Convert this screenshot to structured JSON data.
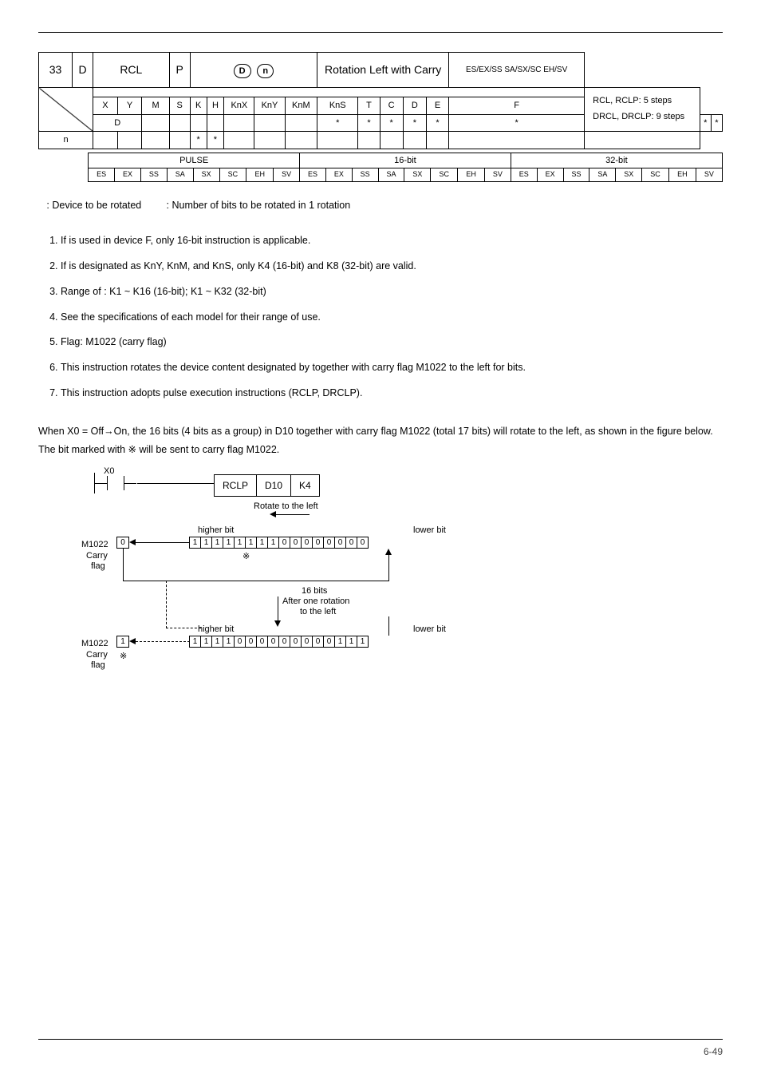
{
  "header": {
    "api_num": "33",
    "d": "D",
    "mnemonic": "RCL",
    "p": "P",
    "operand_d": "D",
    "operand_n": "n",
    "function": "Rotation Left with Carry",
    "models": "ES/EX/SS SA/SX/SC EH/SV"
  },
  "optable": {
    "cols": [
      "X",
      "Y",
      "M",
      "S",
      "K",
      "H",
      "KnX",
      "KnY",
      "KnM",
      "KnS",
      "T",
      "C",
      "D",
      "E",
      "F"
    ],
    "rows": [
      {
        "label": "D",
        "marks": {
          "KnY": "*",
          "KnM": "*",
          "KnS": "*",
          "T": "*",
          "C": "*",
          "D": "*",
          "E": "*",
          "F": "*"
        }
      },
      {
        "label": "n",
        "marks": {
          "K": "*",
          "H": "*"
        }
      }
    ],
    "steps": {
      "line1": "RCL, RCLP: 5 steps",
      "line2": "DRCL, DRCLP: 9 steps"
    }
  },
  "pulse": {
    "groups": [
      "PULSE",
      "16-bit",
      "32-bit"
    ],
    "cols": [
      "ES",
      "EX",
      "SS",
      "SA",
      "SX",
      "SC",
      "EH",
      "SV"
    ]
  },
  "legend": {
    "d": ": Device to be rotated",
    "n": ": Number of bits to be rotated in 1 rotation"
  },
  "explanations": [
    "If     is used in device F, only 16-bit instruction is applicable.",
    "If     is designated as KnY, KnM, and KnS, only K4 (16-bit) and K8 (32-bit) are valid.",
    "Range of   : K1 ~ K16 (16-bit); K1 ~ K32 (32-bit)",
    "See the specifications of each model for their range of use.",
    "Flag: M1022 (carry flag)",
    "This instruction rotates the device content designated by     together with carry flag M1022 to the left for    bits.",
    "This instruction adopts pulse execution instructions (RCLP, DRCLP)."
  ],
  "example": {
    "para": "When X0 = Off→On, the 16 bits (4 bits as a group) in D10 together with carry flag M1022 (total 17 bits) will rotate to the left, as shown in the figure below. The bit marked with ※ will be sent to carry flag M1022."
  },
  "diagram": {
    "x0": "X0",
    "inst": [
      "RCLP",
      "D10",
      "K4"
    ],
    "rotate_label": "Rotate to the left",
    "higher_bit": "higher bit",
    "lower_bit": "lower bit",
    "m1022": "M1022",
    "carry_flag_l1": "Carry",
    "carry_flag_l2": "flag",
    "sixteen_bits": "16 bits",
    "after_l1": "After one rotation",
    "after_l2": "to the left",
    "bits_top": [
      "1",
      "1",
      "1",
      "1",
      "1",
      "1",
      "1",
      "1",
      "0",
      "0",
      "0",
      "0",
      "0",
      "0",
      "0",
      "0"
    ],
    "bits_bottom": [
      "1",
      "1",
      "1",
      "1",
      "0",
      "0",
      "0",
      "0",
      "0",
      "0",
      "0",
      "0",
      "0",
      "1",
      "1",
      "1"
    ],
    "carry_top": "0",
    "carry_bottom": "1"
  },
  "footer": {
    "page": "6-49"
  }
}
